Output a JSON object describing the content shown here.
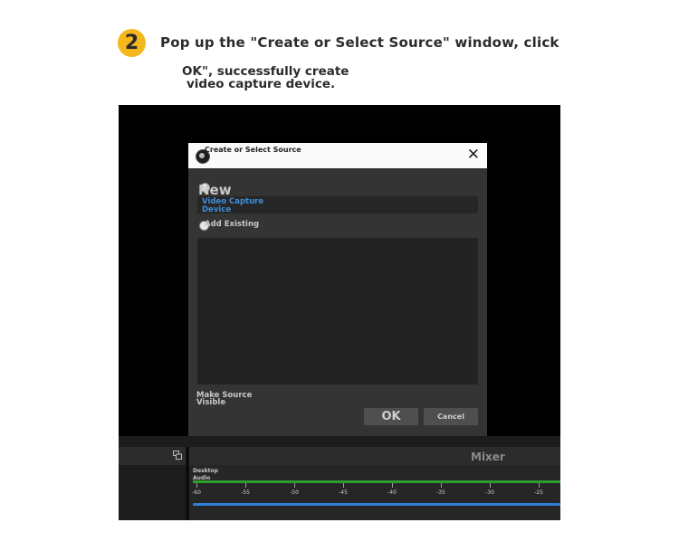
{
  "instruction": {
    "step_number": "2",
    "line1": "Pop up the \"Create or Select Source\" window, click",
    "line2": "OK\", successfully create",
    "line3": "video capture device."
  },
  "dialog": {
    "title": "Create or Select Source",
    "new_label": "New",
    "source_name_value": "Video Capture Device",
    "add_existing_label": "Add Existing",
    "make_visible_label": "Make Source Visible",
    "ok_label": "OK",
    "cancel_label": "Cancel"
  },
  "obs": {
    "mixer_title": "Mixer",
    "source_label": "Desktop Audio",
    "ticks": [
      "-60",
      "-55",
      "-50",
      "-45",
      "-40",
      "-35",
      "-30",
      "-25"
    ]
  },
  "colors": {
    "badge": "#f5b81c",
    "source_name_text": "#3d8ddb",
    "meter_green": "#2ca02c",
    "volume_blue": "#2f7fd6"
  },
  "icons": [
    "close-icon",
    "obs-app-icon",
    "radio-icon",
    "dock-undock-icon"
  ]
}
